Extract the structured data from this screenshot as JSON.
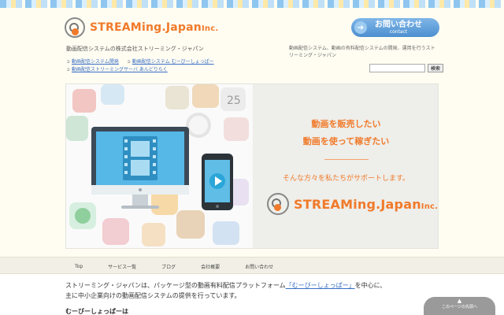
{
  "header": {
    "logo_main": "STREAMing.Japan",
    "logo_inc": "Inc.",
    "tagline": "動画配信システムの株式会社ストリーミング・ジャパン",
    "contact_jp": "お問い合わせ",
    "contact_en": "contact",
    "description": "動画配信システム、動画の有料配信システムの開発、運用を行うストリーミング・ジャパン",
    "links": [
      "動画配信システム開発",
      "動画配信システム むーびーしょっぱー",
      "動画配信ストリーミングサーバ あんどりらく"
    ],
    "search_button": "検索"
  },
  "hero": {
    "line1": "動画を販売したい",
    "line2": "動画を使って稼ぎたい",
    "sub": "そんな方々を私たちがサポートします。",
    "logo_main": "STREAMing.Japan",
    "logo_inc": "Inc."
  },
  "nav": {
    "items": [
      "Top",
      "サービス一覧",
      "ブログ",
      "会社概要",
      "お問い合わせ"
    ]
  },
  "content": {
    "intro_1": "ストリーミング・ジャパンは、パッケージ型の動画有料配信プラットフォーム",
    "intro_link": "「むーびーしょっぱー」",
    "intro_2": "を中心に、",
    "intro_3": "主に中小企業向けの動画配信システムの提供を行っています。",
    "section_heading": "むーびーしょっぱーは"
  },
  "page_top": "このページの先頭へ",
  "colors": {
    "accent": "#f07a2a",
    "link": "#3a6fc4",
    "button": "#5b9bd8"
  }
}
